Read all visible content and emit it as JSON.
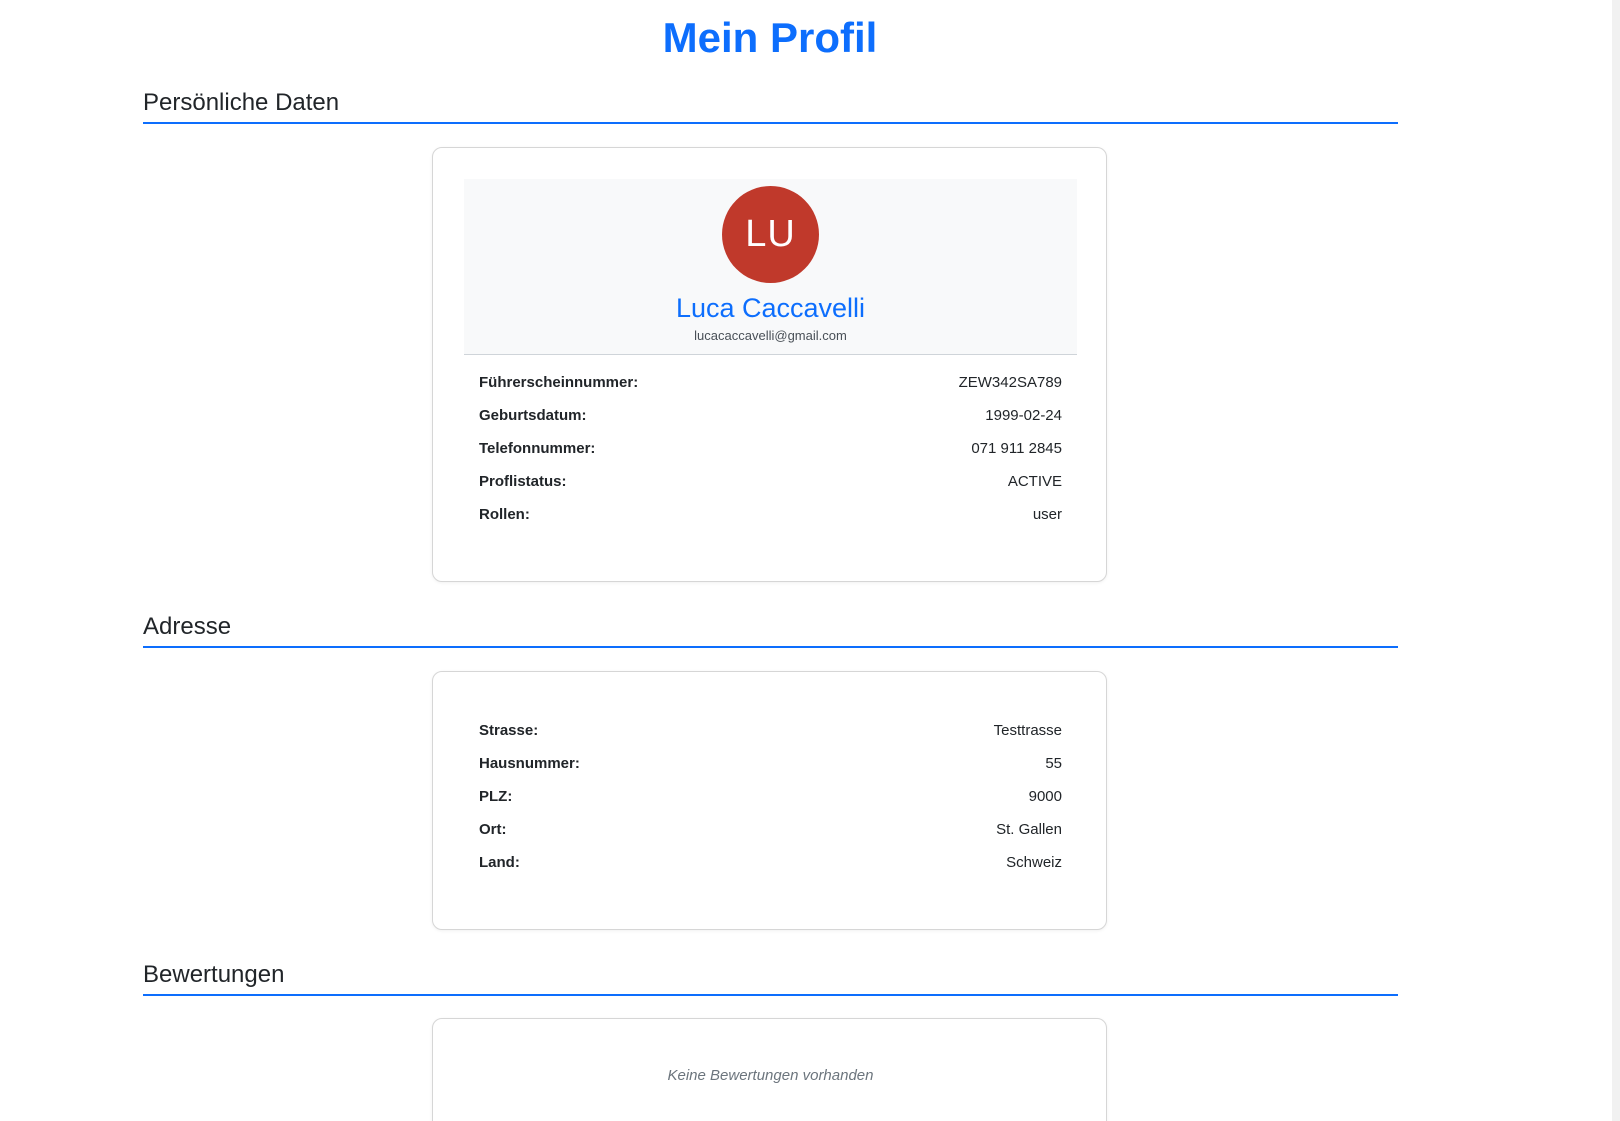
{
  "page": {
    "title": "Mein Profil"
  },
  "personal": {
    "heading": "Persönliche Daten",
    "avatar_initials": "LU",
    "avatar_color": "#c0392b",
    "name": "Luca Caccavelli",
    "email": "lucacaccavelli@gmail.com",
    "rows": [
      {
        "label": "Führerscheinnummer:",
        "value": "ZEW342SA789"
      },
      {
        "label": "Geburtsdatum:",
        "value": "1999-02-24"
      },
      {
        "label": "Telefonnummer:",
        "value": "071 911 2845"
      },
      {
        "label": "Proflistatus:",
        "value": "ACTIVE"
      },
      {
        "label": "Rollen:",
        "value": "user"
      }
    ]
  },
  "address": {
    "heading": "Adresse",
    "rows": [
      {
        "label": "Strasse:",
        "value": "Testtrasse"
      },
      {
        "label": "Hausnummer:",
        "value": "55"
      },
      {
        "label": "PLZ:",
        "value": "9000"
      },
      {
        "label": "Ort:",
        "value": "St. Gallen"
      },
      {
        "label": "Land:",
        "value": "Schweiz"
      }
    ]
  },
  "reviews": {
    "heading": "Bewertungen",
    "empty_text": "Keine Bewertungen vorhanden"
  },
  "colors": {
    "accent": "#0d6efd"
  }
}
